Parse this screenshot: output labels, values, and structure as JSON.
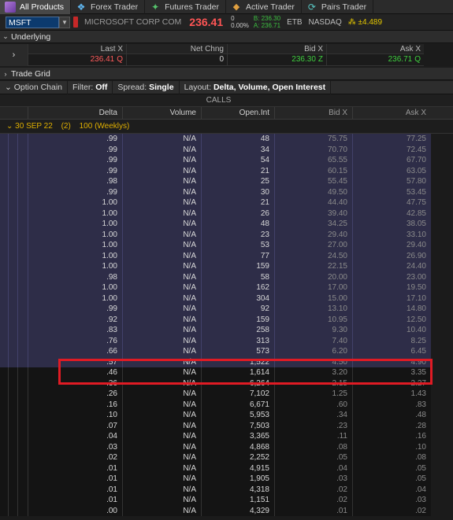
{
  "tabs": [
    {
      "label": "All Products",
      "icon": "all-products-icon",
      "active": true
    },
    {
      "label": "Forex Trader",
      "icon": "forex-icon"
    },
    {
      "label": "Futures Trader",
      "icon": "futures-icon"
    },
    {
      "label": "Active Trader",
      "icon": "active-trader-icon"
    },
    {
      "label": "Pairs Trader",
      "icon": "pairs-trader-icon"
    }
  ],
  "symbol": {
    "ticker": "MSFT",
    "company": "MICROSOFT CORP COM",
    "last": "236.41",
    "net_change": "0",
    "pct_change": "0.00%",
    "bid_line": "B: 236.30",
    "ask_line": "A: 236.71",
    "etb": "ETB",
    "exchange": "NASDAQ",
    "alert": "±4.489"
  },
  "underlying": {
    "section_label": "Underlying",
    "headers": {
      "last": "Last X",
      "net_chng": "Net Chng",
      "bid": "Bid X",
      "ask": "Ask X"
    },
    "values": {
      "last": "236.41",
      "last_ex": "Q",
      "net_chng": "0",
      "bid": "236.30",
      "bid_ex": "Z",
      "ask": "236.71",
      "ask_ex": "Q"
    }
  },
  "trade_grid": {
    "label": "Trade Grid"
  },
  "option_chain": {
    "label": "Option Chain",
    "filter_label": "Filter:",
    "filter_value": "Off",
    "spread_label": "Spread:",
    "spread_value": "Single",
    "layout_label": "Layout:",
    "layout_value": "Delta, Volume, Open Interest"
  },
  "chain": {
    "calls_label": "CALLS",
    "headers": {
      "delta": "Delta",
      "volume": "Volume",
      "open_int": "Open.Int",
      "bid": "Bid X",
      "ask": "Ask X"
    },
    "group": {
      "date": "30 SEP 22",
      "count": "(2)",
      "mult": "100 (Weeklys)"
    },
    "rows": [
      {
        "delta": ".99",
        "vol": "N/A",
        "oi": "48",
        "bid": "75.75",
        "ask": "77.25",
        "itm": true
      },
      {
        "delta": ".99",
        "vol": "N/A",
        "oi": "34",
        "bid": "70.70",
        "ask": "72.45",
        "itm": true
      },
      {
        "delta": ".99",
        "vol": "N/A",
        "oi": "54",
        "bid": "65.55",
        "ask": "67.70",
        "itm": true
      },
      {
        "delta": ".99",
        "vol": "N/A",
        "oi": "21",
        "bid": "60.15",
        "ask": "63.05",
        "itm": true
      },
      {
        "delta": ".98",
        "vol": "N/A",
        "oi": "25",
        "bid": "55.45",
        "ask": "57.80",
        "itm": true
      },
      {
        "delta": ".99",
        "vol": "N/A",
        "oi": "30",
        "bid": "49.50",
        "ask": "53.45",
        "itm": true
      },
      {
        "delta": "1.00",
        "vol": "N/A",
        "oi": "21",
        "bid": "44.40",
        "ask": "47.75",
        "itm": true
      },
      {
        "delta": "1.00",
        "vol": "N/A",
        "oi": "26",
        "bid": "39.40",
        "ask": "42.85",
        "itm": true
      },
      {
        "delta": "1.00",
        "vol": "N/A",
        "oi": "48",
        "bid": "34.25",
        "ask": "38.05",
        "itm": true
      },
      {
        "delta": "1.00",
        "vol": "N/A",
        "oi": "23",
        "bid": "29.40",
        "ask": "33.10",
        "itm": true
      },
      {
        "delta": "1.00",
        "vol": "N/A",
        "oi": "53",
        "bid": "27.00",
        "ask": "29.40",
        "itm": true
      },
      {
        "delta": "1.00",
        "vol": "N/A",
        "oi": "77",
        "bid": "24.50",
        "ask": "26.90",
        "itm": true
      },
      {
        "delta": "1.00",
        "vol": "N/A",
        "oi": "159",
        "bid": "22.15",
        "ask": "24.40",
        "itm": true
      },
      {
        "delta": ".98",
        "vol": "N/A",
        "oi": "58",
        "bid": "20.00",
        "ask": "23.00",
        "itm": true
      },
      {
        "delta": "1.00",
        "vol": "N/A",
        "oi": "162",
        "bid": "17.00",
        "ask": "19.50",
        "itm": true
      },
      {
        "delta": "1.00",
        "vol": "N/A",
        "oi": "304",
        "bid": "15.00",
        "ask": "17.10",
        "itm": true
      },
      {
        "delta": ".99",
        "vol": "N/A",
        "oi": "92",
        "bid": "13.10",
        "ask": "14.80",
        "itm": true
      },
      {
        "delta": ".92",
        "vol": "N/A",
        "oi": "159",
        "bid": "10.95",
        "ask": "12.50",
        "itm": true
      },
      {
        "delta": ".83",
        "vol": "N/A",
        "oi": "258",
        "bid": "9.30",
        "ask": "10.40",
        "itm": true
      },
      {
        "delta": ".76",
        "vol": "N/A",
        "oi": "313",
        "bid": "7.40",
        "ask": "8.25",
        "itm": true
      },
      {
        "delta": ".66",
        "vol": "N/A",
        "oi": "573",
        "bid": "6.20",
        "ask": "6.45",
        "itm": true
      },
      {
        "delta": ".57",
        "vol": "N/A",
        "oi": "1,522",
        "bid": "4.50",
        "ask": "4.90",
        "itm": true
      },
      {
        "delta": ".46",
        "vol": "N/A",
        "oi": "1,614",
        "bid": "3.20",
        "ask": "3.35",
        "itm": false
      },
      {
        "delta": ".36",
        "vol": "N/A",
        "oi": "6,264",
        "bid": "2.15",
        "ask": "2.27",
        "itm": false
      },
      {
        "delta": ".26",
        "vol": "N/A",
        "oi": "7,102",
        "bid": "1.25",
        "ask": "1.43",
        "itm": false
      },
      {
        "delta": ".16",
        "vol": "N/A",
        "oi": "6,671",
        "bid": ".60",
        "ask": ".83",
        "itm": false
      },
      {
        "delta": ".10",
        "vol": "N/A",
        "oi": "5,953",
        "bid": ".34",
        "ask": ".48",
        "itm": false
      },
      {
        "delta": ".07",
        "vol": "N/A",
        "oi": "7,503",
        "bid": ".23",
        "ask": ".28",
        "itm": false
      },
      {
        "delta": ".04",
        "vol": "N/A",
        "oi": "3,365",
        "bid": ".11",
        "ask": ".16",
        "itm": false
      },
      {
        "delta": ".03",
        "vol": "N/A",
        "oi": "4,868",
        "bid": ".08",
        "ask": ".10",
        "itm": false
      },
      {
        "delta": ".02",
        "vol": "N/A",
        "oi": "2,252",
        "bid": ".05",
        "ask": ".08",
        "itm": false
      },
      {
        "delta": ".01",
        "vol": "N/A",
        "oi": "4,915",
        "bid": ".04",
        "ask": ".05",
        "itm": false
      },
      {
        "delta": ".01",
        "vol": "N/A",
        "oi": "1,905",
        "bid": ".03",
        "ask": ".05",
        "itm": false
      },
      {
        "delta": ".01",
        "vol": "N/A",
        "oi": "4,318",
        "bid": ".02",
        "ask": ".04",
        "itm": false
      },
      {
        "delta": ".01",
        "vol": "N/A",
        "oi": "1,151",
        "bid": ".02",
        "ask": ".03",
        "itm": false
      },
      {
        "delta": ".00",
        "vol": "N/A",
        "oi": "4,329",
        "bid": ".01",
        "ask": ".02",
        "itm": false
      }
    ]
  },
  "colors": {
    "itm_bg": "#2e2d48",
    "last_price": "#ff5555",
    "group_label": "#e0b000",
    "highlight": "#e01b24"
  }
}
